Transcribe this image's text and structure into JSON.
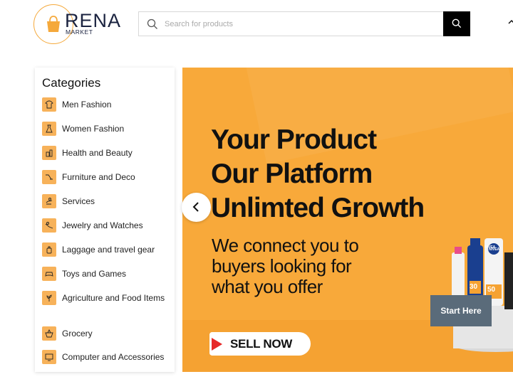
{
  "header": {
    "logo_word": "RENA",
    "logo_sub": "MARKET",
    "search_placeholder": "Search for products"
  },
  "categories": {
    "title": "Categories",
    "items": [
      {
        "label": "Men Fashion",
        "icon": "shirt-icon"
      },
      {
        "label": "Women Fashion",
        "icon": "dress-icon"
      },
      {
        "label": "Health and Beauty",
        "icon": "cosmetics-icon"
      },
      {
        "label": "Furniture and Deco",
        "icon": "lamp-icon"
      },
      {
        "label": "Services",
        "icon": "hand-icon"
      },
      {
        "label": "Jewelry and Watches",
        "icon": "ring-icon"
      },
      {
        "label": "Laggage and travel gear",
        "icon": "luggage-icon"
      },
      {
        "label": "Toys and Games",
        "icon": "gamepad-icon"
      },
      {
        "label": "Agriculture and Food Items",
        "icon": "plant-icon"
      },
      {
        "label": "Grocery",
        "icon": "basket-icon"
      },
      {
        "label": "Computer and Accessories",
        "icon": "computer-icon"
      }
    ]
  },
  "banner": {
    "headline_1": "Your Product",
    "headline_2": "Our Platform",
    "headline_3": "Unlimted Growth",
    "sub_1": "We connect you to",
    "sub_2": "buyers looking for",
    "sub_3": "what you offer",
    "sell_label": "SELL NOW",
    "start_label": "Start Here",
    "product_label_1": "NIVEA",
    "product_label_2": "30",
    "product_label_3": "50",
    "product_label_4": "NIVEA"
  },
  "colors": {
    "brand_orange": "#f8a93a",
    "icon_orange": "#f7b25a",
    "dark_navy": "#1b2340",
    "sell_red": "#e62828"
  }
}
